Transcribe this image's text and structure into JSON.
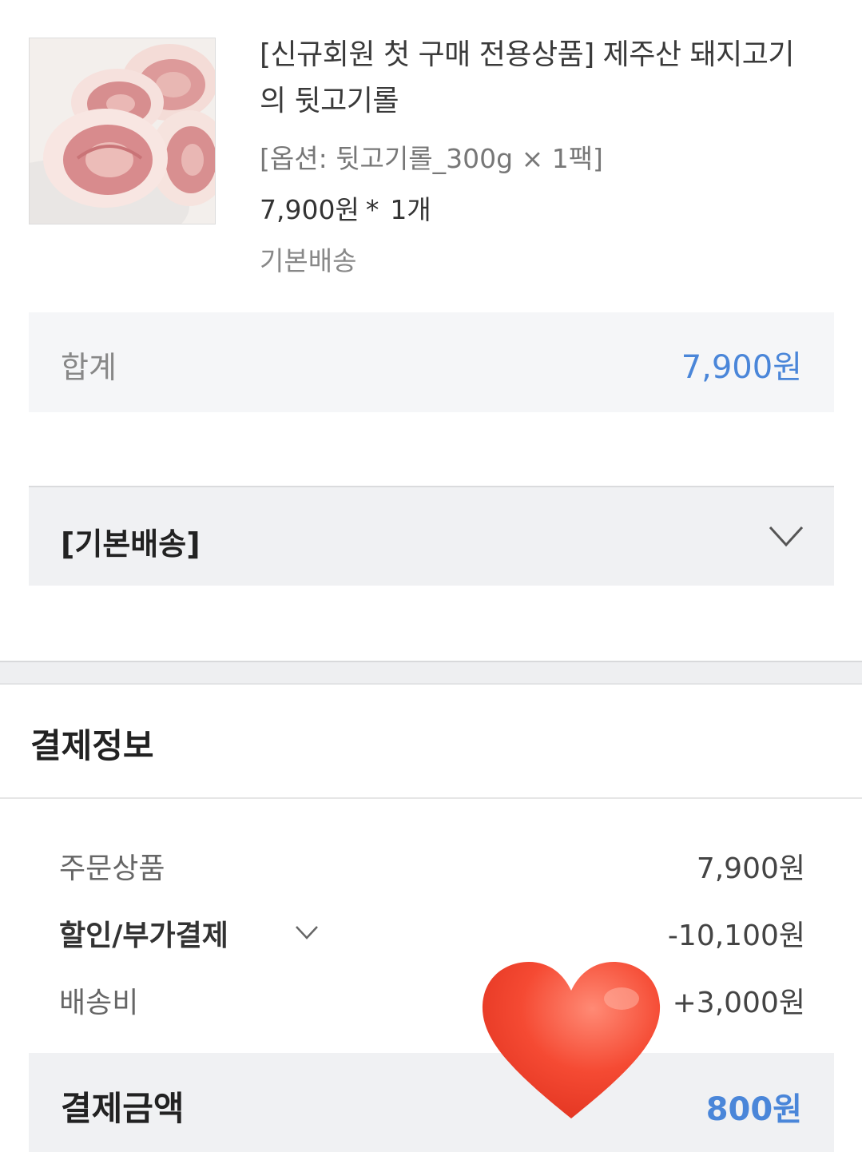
{
  "order_item": {
    "name": "[신규회원 첫 구매 전용상품] 제주산 돼지고기의 뒷고기롤",
    "option": "[옵션: 뒷고기롤_300g × 1팩]",
    "price": "7,900원",
    "multiplier": "*",
    "quantity": "1개",
    "shipping_type": "기본배송",
    "thumbnail_icon": "pork-roll-photo"
  },
  "subtotal": {
    "label": "합계",
    "value": "7,900원"
  },
  "shipping_group": {
    "label": "[기본배송]",
    "toggle_icon": "chevron-down-icon"
  },
  "payment": {
    "title": "결제정보",
    "rows": [
      {
        "label": "주문상품",
        "value": "7,900원"
      },
      {
        "label": "할인/부가결제",
        "value": "-10,100원"
      },
      {
        "label": "배송비",
        "value": "+3,000원"
      }
    ],
    "total_label": "결제금액",
    "total_value": "800원"
  },
  "decoration": {
    "sticker_icon": "heart-icon"
  },
  "colors": {
    "accent": "#4a86d9",
    "panel": "#f5f6f8",
    "heart": "#f2402c"
  }
}
